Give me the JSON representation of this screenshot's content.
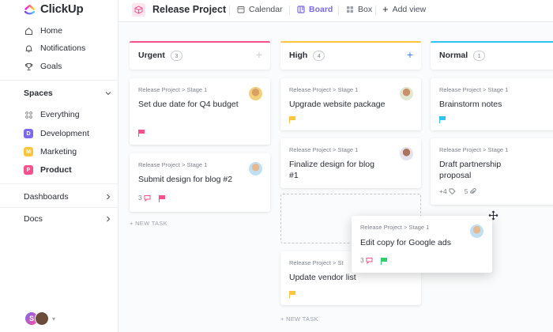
{
  "brand": {
    "name": "ClickUp"
  },
  "nav": {
    "home": "Home",
    "notifications": "Notifications",
    "goals": "Goals"
  },
  "spaces": {
    "title": "Spaces",
    "everything": "Everything",
    "items": [
      {
        "badge": "D",
        "label": "Development",
        "color": "#7b68ee"
      },
      {
        "badge": "M",
        "label": "Marketing",
        "color": "#ffc53d"
      },
      {
        "badge": "P",
        "label": "Product",
        "color": "#f7508c"
      }
    ]
  },
  "dashboards": "Dashboards",
  "docs": "Docs",
  "user": {
    "initial": "S"
  },
  "topbar": {
    "project": "Release Project",
    "views": [
      "Calendar",
      "Board",
      "Box"
    ],
    "add_view": "Add view"
  },
  "columns": [
    {
      "title": "Urgent",
      "count": "3",
      "color": "#f7508c"
    },
    {
      "title": "High",
      "count": "4",
      "color": "#ffc53d"
    },
    {
      "title": "Normal",
      "count": "1",
      "color": "#2ec5f5"
    }
  ],
  "crumb": "Release Project > Stage 1",
  "crumb_truncated": "Release Project > St",
  "cards": {
    "urgent": [
      {
        "title": "Set due date for Q4 budget"
      },
      {
        "title": "Submit design for blog #2",
        "comments": "3"
      }
    ],
    "high": [
      {
        "title": "Upgrade website package"
      },
      {
        "title": "Finalize design for blog #1"
      },
      {
        "title": "Update vendor list"
      }
    ],
    "normal": [
      {
        "title": "Brainstorm notes"
      },
      {
        "title": "Draft partnership proposal",
        "tags": "+4",
        "attachments": "5"
      }
    ],
    "dragging": {
      "title": "Edit copy for Google ads",
      "comments": "3"
    }
  },
  "new_task": "+ NEW TASK",
  "colors": {
    "accent": "#7b68ee",
    "urgent": "#f7508c",
    "high": "#ffc53d",
    "normal": "#2ec5f5",
    "low": "#2ecd6f"
  }
}
